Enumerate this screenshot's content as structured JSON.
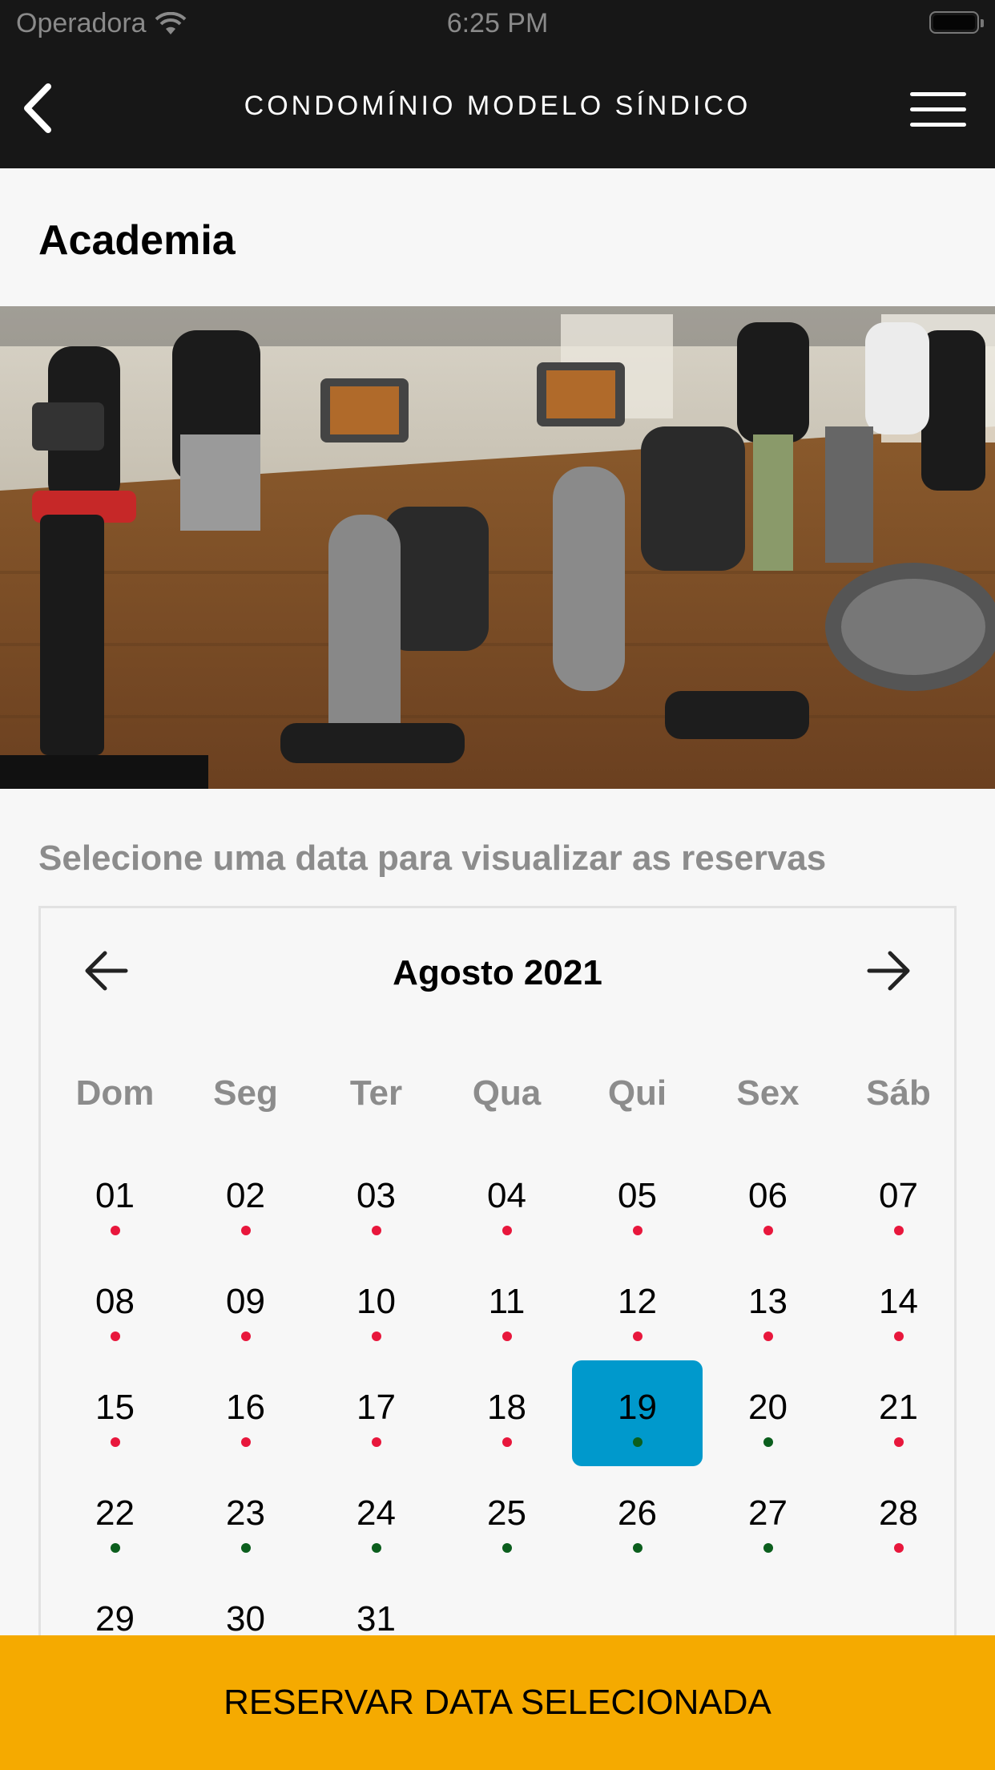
{
  "status_bar": {
    "carrier": "Operadora",
    "time": "6:25 PM"
  },
  "header": {
    "title": "CONDOMÍNIO MODELO SÍNDICO"
  },
  "page": {
    "title": "Academia"
  },
  "calendar": {
    "prompt": "Selecione uma data para visualizar as reservas",
    "month_label": "Agosto 2021",
    "weekdays": [
      "Dom",
      "Seg",
      "Ter",
      "Qua",
      "Qui",
      "Sex",
      "Sáb"
    ],
    "selected_day": "19",
    "days": [
      {
        "label": "01",
        "status": "red"
      },
      {
        "label": "02",
        "status": "red"
      },
      {
        "label": "03",
        "status": "red"
      },
      {
        "label": "04",
        "status": "red"
      },
      {
        "label": "05",
        "status": "red"
      },
      {
        "label": "06",
        "status": "red"
      },
      {
        "label": "07",
        "status": "red"
      },
      {
        "label": "08",
        "status": "red"
      },
      {
        "label": "09",
        "status": "red"
      },
      {
        "label": "10",
        "status": "red"
      },
      {
        "label": "11",
        "status": "red"
      },
      {
        "label": "12",
        "status": "red"
      },
      {
        "label": "13",
        "status": "red"
      },
      {
        "label": "14",
        "status": "red"
      },
      {
        "label": "15",
        "status": "red"
      },
      {
        "label": "16",
        "status": "red"
      },
      {
        "label": "17",
        "status": "red"
      },
      {
        "label": "18",
        "status": "red"
      },
      {
        "label": "19",
        "status": "green"
      },
      {
        "label": "20",
        "status": "green"
      },
      {
        "label": "21",
        "status": "red"
      },
      {
        "label": "22",
        "status": "green"
      },
      {
        "label": "23",
        "status": "green"
      },
      {
        "label": "24",
        "status": "green"
      },
      {
        "label": "25",
        "status": "green"
      },
      {
        "label": "26",
        "status": "green"
      },
      {
        "label": "27",
        "status": "green"
      },
      {
        "label": "28",
        "status": "red"
      },
      {
        "label": "29",
        "status": "none"
      },
      {
        "label": "30",
        "status": "none"
      },
      {
        "label": "31",
        "status": "none"
      }
    ]
  },
  "colors": {
    "red_dot": "#e8173c",
    "green_dot": "#0b5e1d",
    "selected": "#0099cc",
    "cta": "#f5aa00",
    "header": "#171717"
  },
  "cta": {
    "label": "RESERVAR DATA SELECIONADA"
  }
}
